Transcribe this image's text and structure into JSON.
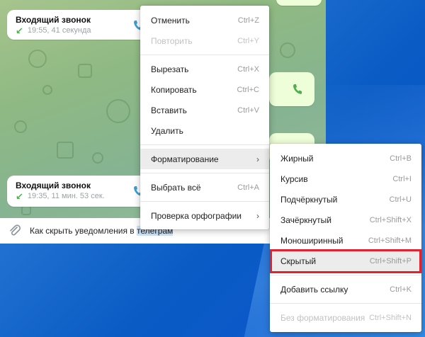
{
  "chat": {
    "calls": [
      {
        "title": "Входящий звонок",
        "meta": "19:55, 41 секунда"
      },
      {
        "title": "Входящий звонок",
        "meta": "19:35, 11 мин. 53 сек."
      }
    ],
    "input_text_before": "Как скрыть уведомления в ",
    "input_text_selected": "телеграм"
  },
  "context_menu": {
    "undo": {
      "label": "Отменить",
      "shortcut": "Ctrl+Z"
    },
    "redo": {
      "label": "Повторить",
      "shortcut": "Ctrl+Y"
    },
    "cut": {
      "label": "Вырезать",
      "shortcut": "Ctrl+X"
    },
    "copy": {
      "label": "Копировать",
      "shortcut": "Ctrl+C"
    },
    "paste": {
      "label": "Вставить",
      "shortcut": "Ctrl+V"
    },
    "delete": {
      "label": "Удалить"
    },
    "formatting": {
      "label": "Форматирование"
    },
    "select_all": {
      "label": "Выбрать всё",
      "shortcut": "Ctrl+A"
    },
    "spellcheck": {
      "label": "Проверка орфографии"
    }
  },
  "format_menu": {
    "bold": {
      "label": "Жирный",
      "shortcut": "Ctrl+B"
    },
    "italic": {
      "label": "Курсив",
      "shortcut": "Ctrl+I"
    },
    "underline": {
      "label": "Подчёркнутый",
      "shortcut": "Ctrl+U"
    },
    "strike": {
      "label": "Зачёркнутый",
      "shortcut": "Ctrl+Shift+X"
    },
    "mono": {
      "label": "Моноширинный",
      "shortcut": "Ctrl+Shift+M"
    },
    "spoiler": {
      "label": "Скрытый",
      "shortcut": "Ctrl+Shift+P"
    },
    "link": {
      "label": "Добавить ссылку",
      "shortcut": "Ctrl+K"
    },
    "clear": {
      "label": "Без форматирования",
      "shortcut": "Ctrl+Shift+N"
    }
  },
  "colors": {
    "accent_highlight": "#e1232f",
    "call_arrow": "#4fae4e",
    "phone_icon": "#3b9ed8"
  }
}
